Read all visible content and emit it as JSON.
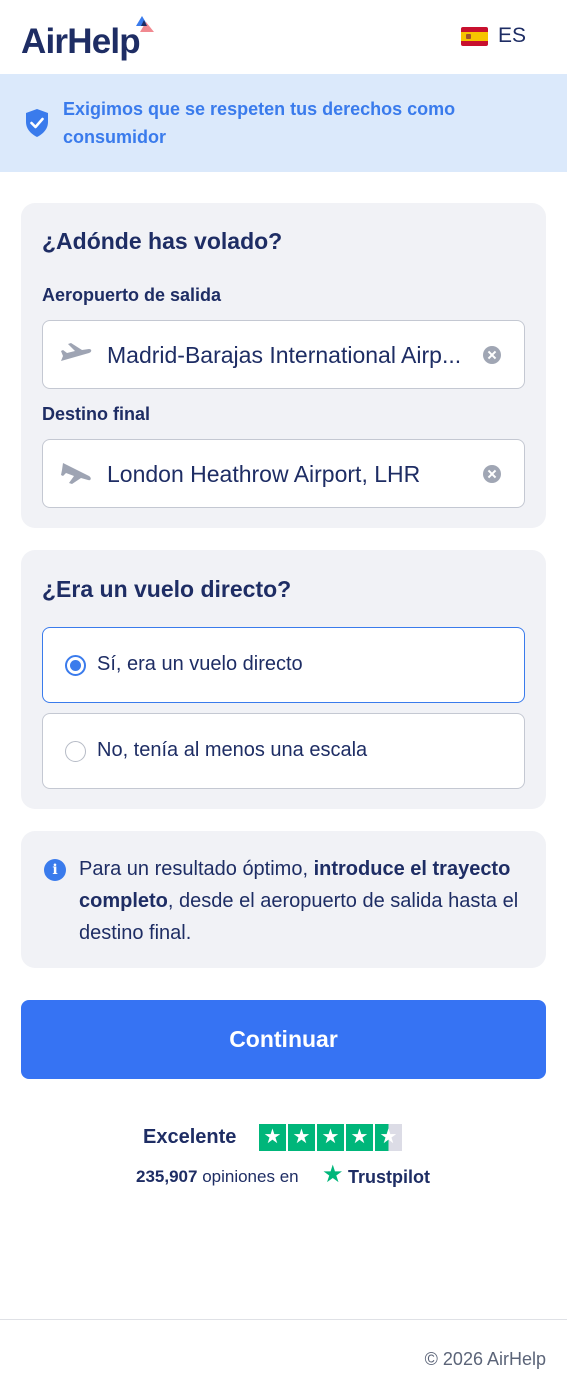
{
  "header": {
    "logo_text": "AirHelp",
    "language_code": "ES",
    "flag_icon": "spain-flag-icon"
  },
  "banner": {
    "icon": "shield-check-icon",
    "text": "Exigimos que se respeten tus derechos como consumidor",
    "background_color": "#dbe9fb",
    "text_color": "#3a7bec"
  },
  "route_card": {
    "title": "¿Adónde has volado?",
    "departure": {
      "label": "Aeropuerto de salida",
      "value": "Madrid-Barajas International Airp...",
      "icon": "plane-takeoff-icon"
    },
    "destination": {
      "label": "Destino final",
      "value": "London Heathrow Airport, LHR",
      "icon": "plane-landing-icon"
    }
  },
  "direct_card": {
    "title": "¿Era un vuelo directo?",
    "options": [
      {
        "label": "Sí, era un vuelo directo",
        "selected": true
      },
      {
        "label": "No, tenía al menos una escala",
        "selected": false
      }
    ]
  },
  "info_card": {
    "icon": "info-icon",
    "text_before": "Para un resultado óptimo, ",
    "text_bold": "introduce el trayecto completo",
    "text_after": ", desde el aeropuerto de salida hasta el destino final."
  },
  "continue_button": {
    "label": "Continuar",
    "color": "#3673f3"
  },
  "trustpilot": {
    "rating_label": "Excelente",
    "stars": 4.5,
    "review_count": "235,907",
    "reviews_text": "opiniones en",
    "brand": "Trustpilot",
    "star_color": "#00b67a"
  },
  "footer": {
    "copyright": "© 2026 AirHelp"
  }
}
